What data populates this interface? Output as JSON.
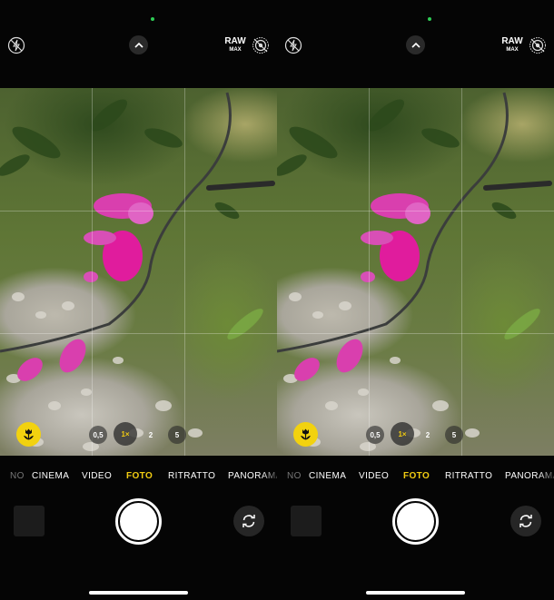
{
  "top_bar": {
    "flash_icon": "flash-off-icon",
    "controls_icon": "chevron-up-icon",
    "raw_label": "RAW",
    "raw_sub_label": "MAX",
    "live_photo_icon": "live-photo-off-icon"
  },
  "viewfinder": {
    "macro_icon": "macro-flower-icon",
    "zoom_levels": [
      "0,5",
      "1×",
      "2",
      "5"
    ],
    "active_zoom": "1×"
  },
  "modes": [
    "NO",
    "CINEMA",
    "VIDEO",
    "FOTO",
    "RITRATTO",
    "PANORAMA"
  ],
  "active_mode": "FOTO",
  "bottom_bar": {
    "thumbnail": "last-photo-thumbnail",
    "shutter": "shutter-button",
    "flip_icon": "flip-camera-icon"
  },
  "colors": {
    "accent": "#f2cc12",
    "macro": "#f2d20f",
    "indicator": "#2ecc55",
    "background": "#000000"
  }
}
